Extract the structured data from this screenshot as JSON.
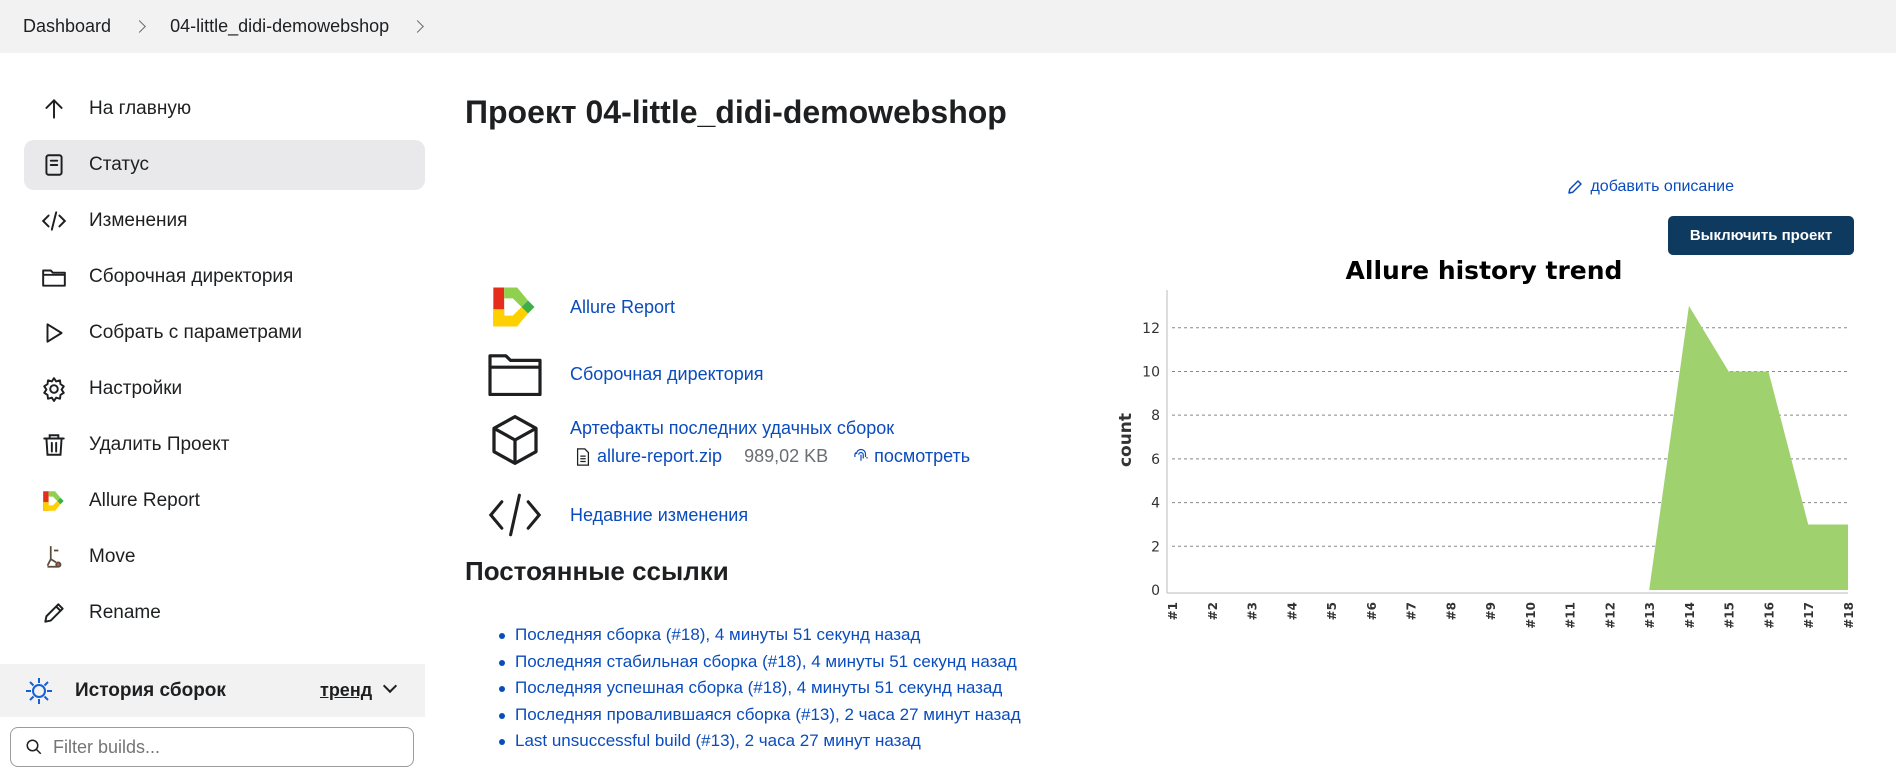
{
  "breadcrumb": {
    "items": [
      "Dashboard",
      "04-little_didi-demowebshop"
    ]
  },
  "sidebar": {
    "items": [
      {
        "label": "На главную",
        "icon": "arrow-up-icon"
      },
      {
        "label": "Статус",
        "icon": "document-icon"
      },
      {
        "label": "Изменения",
        "icon": "code-icon"
      },
      {
        "label": "Сборочная директория",
        "icon": "folder-icon"
      },
      {
        "label": "Собрать с параметрами",
        "icon": "play-icon"
      },
      {
        "label": "Настройки",
        "icon": "gear-icon"
      },
      {
        "label": "Удалить Проект",
        "icon": "trash-icon"
      },
      {
        "label": "Allure Report",
        "icon": "allure-logo-icon"
      },
      {
        "label": "Move",
        "icon": "move-icon"
      },
      {
        "label": "Rename",
        "icon": "pencil-icon"
      }
    ],
    "history": {
      "label": "История сборок",
      "trend": "тренд"
    },
    "filter": {
      "placeholder": "Filter builds..."
    }
  },
  "main": {
    "title": "Проект 04-little_didi-demowebshop",
    "add_description": "добавить описание",
    "disable_button": "Выключить проект",
    "links": {
      "allure": "Allure Report",
      "workspace": "Сборочная директория",
      "artifacts": "Артефакты последних удачных сборок",
      "artifact_file": "allure-report.zip",
      "artifact_size": "989,02 KB",
      "artifact_view": "посмотреть",
      "changes": "Недавние изменения"
    },
    "permalinks": {
      "title": "Постоянные ссылки",
      "items": [
        "Последняя сборка (#18), 4 минуты 51 секунд назад",
        "Последняя стабильная сборка (#18), 4 минуты 51 секунд назад",
        "Последняя успешная сборка (#18), 4 минуты 51 секунд назад",
        "Последняя провалившаяся сборка (#13), 2 часа 27 минут назад",
        "Last unsuccessful build (#13), 2 часа 27 минут назад"
      ]
    }
  },
  "chart_data": {
    "type": "area",
    "title": "Allure history trend",
    "ylabel": "count",
    "x": [
      "#1",
      "#2",
      "#3",
      "#4",
      "#5",
      "#6",
      "#7",
      "#8",
      "#9",
      "#10",
      "#11",
      "#12",
      "#13",
      "#14",
      "#15",
      "#16",
      "#17",
      "#18"
    ],
    "series": [
      {
        "values": [
          0,
          0,
          0,
          0,
          0,
          0,
          0,
          0,
          0,
          0,
          0,
          0,
          0,
          13,
          10,
          10,
          3,
          3
        ]
      }
    ],
    "yticks": [
      0,
      2,
      4,
      6,
      8,
      10,
      12
    ],
    "ylim": [
      0,
      13.5
    ],
    "grid": true,
    "color": "#9fd16f"
  }
}
